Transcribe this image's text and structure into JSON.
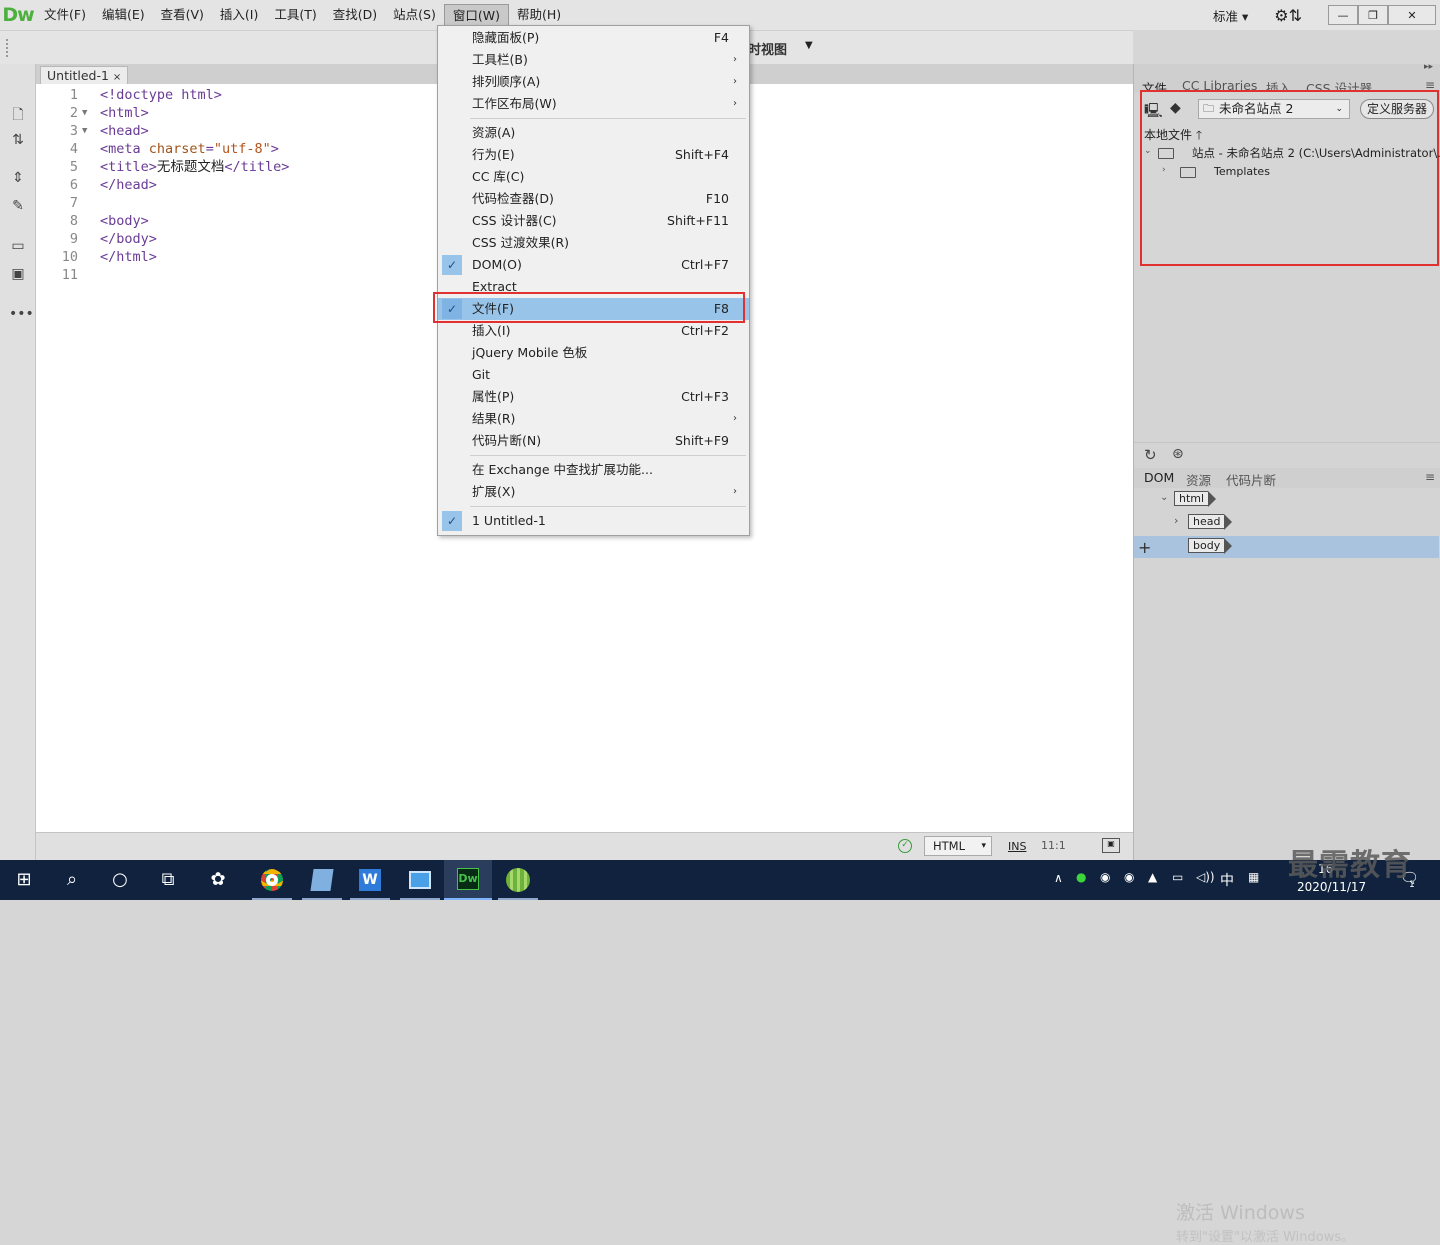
{
  "app": {
    "logo": "Dw",
    "menu": [
      "文件(F)",
      "编辑(E)",
      "查看(V)",
      "插入(I)",
      "工具(T)",
      "查找(D)",
      "站点(S)",
      "窗口(W)",
      "帮助(H)"
    ],
    "workspace": "标准",
    "view_label": "时视图"
  },
  "document": {
    "tab_title": "Untitled-1",
    "tab_close": "×",
    "lines": [
      {
        "n": "1",
        "fold": "",
        "parts": [
          {
            "t": "<!doctype html>",
            "c": "tag"
          }
        ]
      },
      {
        "n": "2",
        "fold": "▼",
        "parts": [
          {
            "t": "<html>",
            "c": "tag"
          }
        ]
      },
      {
        "n": "3",
        "fold": "▼",
        "parts": [
          {
            "t": "<head>",
            "c": "tag"
          }
        ]
      },
      {
        "n": "4",
        "fold": "",
        "parts": [
          {
            "t": "<meta ",
            "c": "tag"
          },
          {
            "t": "charset",
            "c": "attr"
          },
          {
            "t": "=",
            "c": "tag"
          },
          {
            "t": "\"utf-8\"",
            "c": "val"
          },
          {
            "t": ">",
            "c": "tag"
          }
        ]
      },
      {
        "n": "5",
        "fold": "",
        "parts": [
          {
            "t": "<title>",
            "c": "tag"
          },
          {
            "t": "无标题文档",
            "c": "txt"
          },
          {
            "t": "</title>",
            "c": "tag"
          }
        ]
      },
      {
        "n": "6",
        "fold": "",
        "parts": [
          {
            "t": "</head>",
            "c": "tag"
          }
        ]
      },
      {
        "n": "7",
        "fold": "",
        "parts": []
      },
      {
        "n": "8",
        "fold": "",
        "parts": [
          {
            "t": "<body>",
            "c": "tag"
          }
        ]
      },
      {
        "n": "9",
        "fold": "",
        "parts": [
          {
            "t": "</body>",
            "c": "tag"
          }
        ]
      },
      {
        "n": "10",
        "fold": "",
        "parts": [
          {
            "t": "</html>",
            "c": "tag"
          }
        ]
      },
      {
        "n": "11",
        "fold": "",
        "parts": []
      }
    ]
  },
  "status": {
    "language": "HTML",
    "mode": "INS",
    "position": "11:1"
  },
  "window_menu": {
    "items": [
      {
        "label": "隐藏面板(P)",
        "shortcut": "F4",
        "submenu": false,
        "checked": false
      },
      {
        "label": "工具栏(B)",
        "shortcut": "",
        "submenu": true,
        "checked": false
      },
      {
        "label": "排列顺序(A)",
        "shortcut": "",
        "submenu": true,
        "checked": false
      },
      {
        "label": "工作区布局(W)",
        "shortcut": "",
        "submenu": true,
        "checked": false,
        "sep_after": true
      },
      {
        "label": "资源(A)",
        "shortcut": "",
        "submenu": false,
        "checked": false
      },
      {
        "label": "行为(E)",
        "shortcut": "Shift+F4",
        "submenu": false,
        "checked": false
      },
      {
        "label": "CC 库(C)",
        "shortcut": "",
        "submenu": false,
        "checked": false
      },
      {
        "label": "代码检查器(D)",
        "shortcut": "F10",
        "submenu": false,
        "checked": false
      },
      {
        "label": "CSS 设计器(C)",
        "shortcut": "Shift+F11",
        "submenu": false,
        "checked": false
      },
      {
        "label": "CSS 过渡效果(R)",
        "shortcut": "",
        "submenu": false,
        "checked": false
      },
      {
        "label": "DOM(O)",
        "shortcut": "Ctrl+F7",
        "submenu": false,
        "checked": true
      },
      {
        "label": "Extract",
        "shortcut": "",
        "submenu": false,
        "checked": false
      },
      {
        "label": "文件(F)",
        "shortcut": "F8",
        "submenu": false,
        "checked": true,
        "highlighted": true
      },
      {
        "label": "插入(I)",
        "shortcut": "Ctrl+F2",
        "submenu": false,
        "checked": false
      },
      {
        "label": "jQuery Mobile 色板",
        "shortcut": "",
        "submenu": false,
        "checked": false
      },
      {
        "label": "Git",
        "shortcut": "",
        "submenu": false,
        "checked": false
      },
      {
        "label": "属性(P)",
        "shortcut": "Ctrl+F3",
        "submenu": false,
        "checked": false
      },
      {
        "label": "结果(R)",
        "shortcut": "",
        "submenu": true,
        "checked": false
      },
      {
        "label": "代码片断(N)",
        "shortcut": "Shift+F9",
        "submenu": false,
        "checked": false,
        "sep_after": true
      },
      {
        "label": "在 Exchange 中查找扩展功能...",
        "shortcut": "",
        "submenu": false,
        "checked": false
      },
      {
        "label": "扩展(X)",
        "shortcut": "",
        "submenu": true,
        "checked": false,
        "sep_after": true
      },
      {
        "label": "1 Untitled-1",
        "shortcut": "",
        "submenu": false,
        "checked": true
      }
    ]
  },
  "files_panel": {
    "tabs": [
      "文件",
      "CC Libraries",
      "插入",
      "CSS 设计器"
    ],
    "site_name": "未命名站点 2",
    "define_server": "定义服务器",
    "local_files": "本地文件",
    "site_root": "站点 - 未命名站点 2 (C:\\Users\\Administrator\\...",
    "templates": "Templates"
  },
  "dom_panel": {
    "tabs": [
      "DOM",
      "资源",
      "代码片断"
    ],
    "nodes": [
      "html",
      "head",
      "body"
    ]
  },
  "watermark": {
    "line1": "激活 Windows",
    "line2": "转到\"设置\"以激活 Windows。"
  },
  "taskbar": {
    "tray_ime": "中",
    "clock_time": "16",
    "clock_date": "2020/11/17",
    "notif_count": "1",
    "brand": "最需教育"
  }
}
